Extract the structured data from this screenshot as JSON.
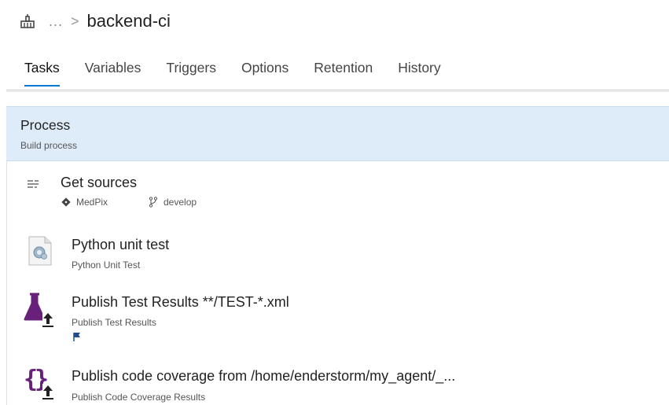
{
  "colors": {
    "accent": "#0078d4",
    "selected_section_bg": "#deecf9",
    "task_icon_purple": "#68217a"
  },
  "breadcrumb": {
    "icon": "build-pipeline-icon",
    "ellipsis": "...",
    "separator": ">",
    "title": "backend-ci"
  },
  "tabs": [
    {
      "label": "Tasks",
      "active": true
    },
    {
      "label": "Variables",
      "active": false
    },
    {
      "label": "Triggers",
      "active": false
    },
    {
      "label": "Options",
      "active": false
    },
    {
      "label": "Retention",
      "active": false
    },
    {
      "label": "History",
      "active": false
    }
  ],
  "process": {
    "title": "Process",
    "subtitle": "Build process"
  },
  "tasks": [
    {
      "title": "Get sources",
      "icon": "get-sources-icon",
      "repo": "MedPix",
      "repo_icon": "git-repo-icon",
      "branch": "develop",
      "branch_icon": "git-branch-icon"
    },
    {
      "title": "Python unit test",
      "subtitle": "Python Unit Test",
      "icon": "python-script-icon"
    },
    {
      "title": "Publish Test Results **/TEST-*.xml",
      "subtitle": "Publish Test Results",
      "icon": "publish-test-results-icon",
      "flag_icon": "flag-icon"
    },
    {
      "title": "Publish code coverage from /home/enderstorm/my_agent/_...",
      "subtitle": "Publish Code Coverage Results",
      "icon": "publish-code-coverage-icon"
    }
  ]
}
